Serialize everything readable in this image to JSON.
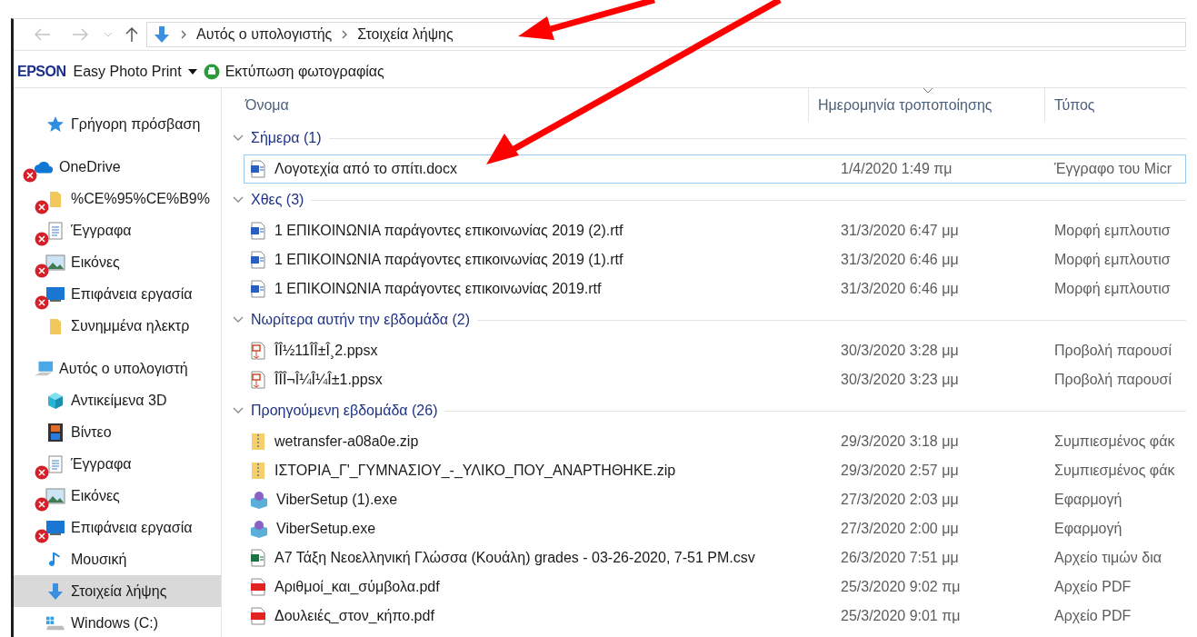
{
  "address_bar": {
    "crumbs": [
      "Αυτός ο υπολογιστής",
      "Στοιχεία λήψης"
    ]
  },
  "toolbar": {
    "brand": "EPSON",
    "app": "Easy Photo Print",
    "action": "Εκτύπωση φωτογραφίας"
  },
  "sidebar": {
    "items": [
      {
        "label": "Γρήγορη πρόσβαση",
        "kind": "star",
        "error": false,
        "selected": false
      },
      {
        "label": "OneDrive",
        "kind": "cloud",
        "error": true,
        "selected": false,
        "children": [
          {
            "label": "%CE%95%CE%B9%",
            "kind": "folder",
            "error": true,
            "selected": false
          },
          {
            "label": "Έγγραφα",
            "kind": "docs",
            "error": true,
            "selected": false
          },
          {
            "label": "Εικόνες",
            "kind": "pictures",
            "error": true,
            "selected": false
          },
          {
            "label": "Επιφάνεια εργασία",
            "kind": "desktop",
            "error": true,
            "selected": false
          },
          {
            "label": "Συνημμένα ηλεκτρ",
            "kind": "folder",
            "error": false,
            "selected": false
          }
        ]
      },
      {
        "label": "Αυτός ο υπολογιστή",
        "kind": "pc",
        "error": false,
        "selected": false,
        "children": [
          {
            "label": "Αντικείμενα 3D",
            "kind": "cube",
            "error": false,
            "selected": false
          },
          {
            "label": "Βίντεο",
            "kind": "video",
            "error": false,
            "selected": false
          },
          {
            "label": "Έγγραφα",
            "kind": "docs",
            "error": true,
            "selected": false
          },
          {
            "label": "Εικόνες",
            "kind": "pictures",
            "error": true,
            "selected": false
          },
          {
            "label": "Επιφάνεια εργασία",
            "kind": "desktop",
            "error": true,
            "selected": false
          },
          {
            "label": "Μουσική",
            "kind": "music",
            "error": false,
            "selected": false
          },
          {
            "label": "Στοιχεία λήψης",
            "kind": "download",
            "error": false,
            "selected": true
          },
          {
            "label": "Windows (C:)",
            "kind": "drive",
            "error": false,
            "selected": false
          }
        ]
      }
    ]
  },
  "table": {
    "columns": [
      {
        "label": "Όνομα",
        "sorted": false
      },
      {
        "label": "Ημερομηνία τροποποίησης",
        "sorted": true
      },
      {
        "label": "Τύπος",
        "sorted": false
      }
    ],
    "groups": [
      {
        "title": "Σήμερα (1)",
        "expanded": true,
        "rows": [
          {
            "kind": "word",
            "name": "Λογοτεχία από το σπίτι.docx",
            "date": "1/4/2020 1:49 πμ",
            "type": "Έγγραφο του Micr",
            "focused": true
          }
        ]
      },
      {
        "title": "Χθες (3)",
        "expanded": true,
        "rows": [
          {
            "kind": "word",
            "name": "1 ΕΠΙΚΟΙΝΩΝΙΑ παράγοντες επικοινωνίας 2019 (2).rtf",
            "date": "31/3/2020 6:47 μμ",
            "type": "Μορφή εμπλουτισ",
            "focused": false
          },
          {
            "kind": "word",
            "name": "1 ΕΠΙΚΟΙΝΩΝΙΑ παράγοντες επικοινωνίας 2019 (1).rtf",
            "date": "31/3/2020 6:46 μμ",
            "type": "Μορφή εμπλουτισ",
            "focused": false
          },
          {
            "kind": "word",
            "name": "1 ΕΠΙΚΟΙΝΩΝΙΑ παράγοντες επικοινωνίας 2019.rtf",
            "date": "31/3/2020 6:46 μμ",
            "type": "Μορφή εμπλουτισ",
            "focused": false
          }
        ]
      },
      {
        "title": "Νωρίτερα αυτήν την εβδομάδα (2)",
        "expanded": true,
        "rows": [
          {
            "kind": "slideshow",
            "name": "ÎÎ½11ÎÎ±Î¸2.ppsx",
            "date": "30/3/2020 3:28 μμ",
            "type": "Προβολή παρουσί",
            "focused": false
          },
          {
            "kind": "slideshow",
            "name": "ÎÎÎ¬Î¼Î¼Î±1.ppsx",
            "date": "30/3/2020 3:23 μμ",
            "type": "Προβολή παρουσί",
            "focused": false
          }
        ]
      },
      {
        "title": "Προηγούμενη εβδομάδα (26)",
        "expanded": true,
        "rows": [
          {
            "kind": "zip",
            "name": "wetransfer-a08a0e.zip",
            "date": "29/3/2020 3:18 μμ",
            "type": "Συμπιεσμένος φάκ",
            "focused": false
          },
          {
            "kind": "zip",
            "name": "ΙΣΤΟΡΙΑ_Γ'_ΓΥΜΝΑΣΙΟΥ_-_ΥΛΙΚΟ_ΠΟΥ_ΑΝΑΡΤΗΘΗΚΕ.zip",
            "date": "29/3/2020 2:57 μμ",
            "type": "Συμπιεσμένος φάκ",
            "focused": false
          },
          {
            "kind": "exe",
            "name": "ViberSetup (1).exe",
            "date": "27/3/2020 2:03 μμ",
            "type": "Εφαρμογή",
            "focused": false
          },
          {
            "kind": "exe",
            "name": "ViberSetup.exe",
            "date": "27/3/2020 2:00 μμ",
            "type": "Εφαρμογή",
            "focused": false
          },
          {
            "kind": "sheet",
            "name": "Α7 Τάξη Νεοελληνική Γλώσσα (Κουάλη) grades - 03-26-2020, 7-51 PM.csv",
            "date": "26/3/2020 7:51 μμ",
            "type": "Αρχείο τιμών δια",
            "focused": false
          },
          {
            "kind": "pdf",
            "name": "Αριθμοί_και_σύμβολα.pdf",
            "date": "25/3/2020 9:02 πμ",
            "type": "Αρχείο PDF",
            "focused": false
          },
          {
            "kind": "pdf",
            "name": "Δουλειές_στον_κήπο.pdf",
            "date": "25/3/2020 9:01 πμ",
            "type": "Αρχείο PDF",
            "focused": false
          }
        ]
      }
    ]
  }
}
